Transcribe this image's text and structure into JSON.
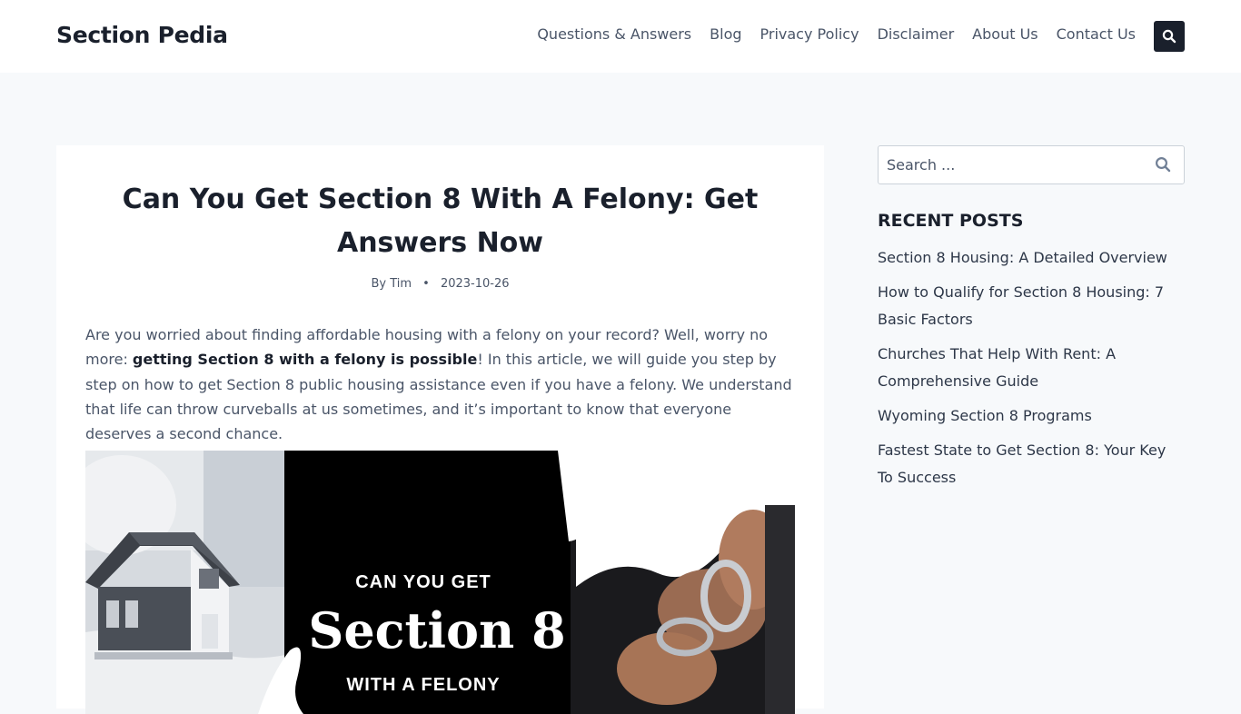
{
  "site": {
    "title": "Section Pedia"
  },
  "nav": {
    "items": [
      {
        "label": "Questions & Answers"
      },
      {
        "label": "Blog"
      },
      {
        "label": "Privacy Policy"
      },
      {
        "label": "Disclaimer"
      },
      {
        "label": "About Us"
      },
      {
        "label": "Contact Us"
      }
    ],
    "search_icon": "search-icon"
  },
  "article": {
    "title": "Can You Get Section 8 With A Felony: Get Answers Now",
    "author": "By Tim",
    "date": "2023-10-26",
    "intro_lead": "Are you worried about finding affordable housing with a felony on your record? Well, worry no more: ",
    "intro_bold": "getting Section 8 with a felony is possible",
    "intro_rest": "! In this article, we will guide you step by step on how to get Section 8 public housing assistance even if you have a felony. We understand that life can throw curveballs at us sometimes, and it’s important to know that everyone deserves a second chance.",
    "hero": {
      "line1": "CAN YOU GET",
      "line2": "Section 8",
      "line3": "WITH A FELONY"
    }
  },
  "sidebar": {
    "search_placeholder": "Search ...",
    "recent_title": "RECENT POSTS",
    "recent_posts": [
      "Section 8 Housing: A Detailed Overview",
      "How to Qualify for Section 8 Housing: 7 Basic Factors",
      "Churches That Help With Rent: A Comprehensive Guide",
      "Wyoming Section 8 Programs",
      "Fastest State to Get Section 8: Your Key To Success"
    ]
  },
  "colors": {
    "background": "#f7f9fb",
    "header": "#ffffff",
    "heading": "#1a202c",
    "text": "#4a5568",
    "search_button": "#1a202c"
  }
}
